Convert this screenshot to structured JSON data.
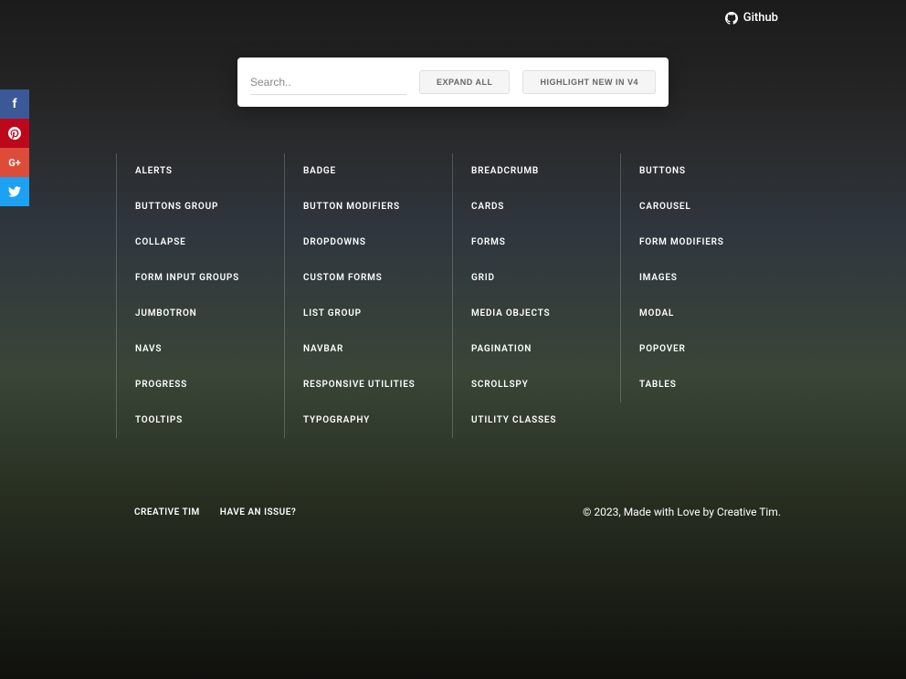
{
  "header": {
    "github_label": "Github"
  },
  "social": {
    "facebook": "f",
    "pinterest": "●",
    "googleplus": "G+",
    "twitter": "t"
  },
  "search": {
    "placeholder": "Search..",
    "expand_label": "EXPAND ALL",
    "highlight_label": "HIGHLIGHT NEW IN V4"
  },
  "grid": {
    "items": [
      "ALERTS",
      "BADGE",
      "BREADCRUMB",
      "BUTTONS",
      "BUTTONS GROUP",
      "BUTTON MODIFIERS",
      "CARDS",
      "CAROUSEL",
      "COLLAPSE",
      "DROPDOWNS",
      "FORMS",
      "FORM MODIFIERS",
      "FORM INPUT GROUPS",
      "CUSTOM FORMS",
      "GRID",
      "IMAGES",
      "JUMBOTRON",
      "LIST GROUP",
      "MEDIA OBJECTS",
      "MODAL",
      "NAVS",
      "NAVBAR",
      "PAGINATION",
      "POPOVER",
      "PROGRESS",
      "RESPONSIVE UTILITIES",
      "SCROLLSPY",
      "TABLES",
      "TOOLTIPS",
      "TYPOGRAPHY",
      "UTILITY CLASSES"
    ]
  },
  "footer": {
    "creative_tim": "CREATIVE TIM",
    "have_issue": "HAVE AN ISSUE?",
    "copyright": "© 2023, Made with Love by Creative Tim."
  }
}
